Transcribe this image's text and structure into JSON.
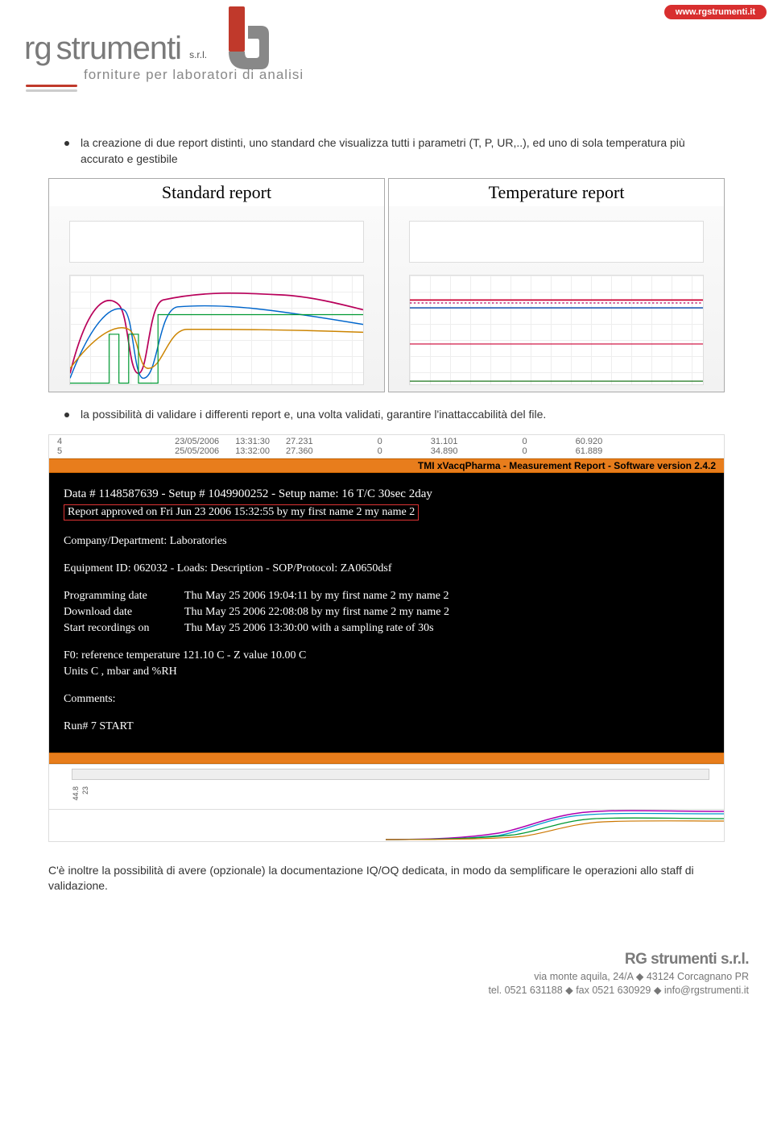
{
  "header": {
    "website": "www.rgstrumenti.it",
    "brand_rg": "rg",
    "brand_strumenti": "strumenti",
    "brand_srl": "s.r.l.",
    "tagline": "forniture per laboratori di analisi"
  },
  "bullets": {
    "b1": "la creazione di due report distinti, uno standard che visualizza tutti i parametri (T, P, UR,..), ed uno di sola temperatura più accurato e gestibile",
    "b2": "la possibilità di validare i differenti report e, una volta validati, garantire l'inattaccabilità del file."
  },
  "screenshots": {
    "left_title": "Standard report",
    "right_title": "Temperature report"
  },
  "report": {
    "top_row1_a": "4",
    "top_row1_b": "23/05/2006",
    "top_row1_c": "13:31:30",
    "top_row1_d": "27.231",
    "top_row1_e": "0",
    "top_row1_f": "31.101",
    "top_row1_g": "0",
    "top_row1_h": "60.920",
    "top_row2_a": "5",
    "top_row2_b": "25/05/2006",
    "top_row2_c": "13:32:00",
    "top_row2_d": "27.360",
    "top_row2_e": "0",
    "top_row2_f": "34.890",
    "top_row2_g": "0",
    "top_row2_h": "61.889",
    "bar_title": "TMI xVacqPharma - Measurement Report - Software version 2.4.2",
    "data_line": "Data # 1148587639  -  Setup # 1049900252  -  Setup name: 16 T/C 30sec 2day",
    "approved_line": "Report approved on Fri Jun 23 2006 15:32:55 by my first name 2 my name 2",
    "company_line": "Company/Department: Laboratories",
    "equip_line": "Equipment ID: 062032  -  Loads: Description  -  SOP/Protocol: ZA0650dsf",
    "prog_label": "Programming date",
    "prog_val": "Thu May 25 2006 19:04:11 by my first name 2 my name 2",
    "dl_label": "Download date",
    "dl_val": "Thu May 25 2006 22:08:08 by my first name 2 my name 2",
    "start_label": "Start recordings on",
    "start_val": "Thu May 25 2006 13:30:00 with a sampling rate of 30s",
    "f0_line": "F0: reference temperature 121.10 C    -  Z value 10.00 C",
    "units_line": "Units  C  , mbar  and %RH",
    "comments_line": "Comments:",
    "run_line": "Run# 7 START",
    "tick1": "44.8",
    "tick2": "23"
  },
  "final_para": "C'è inoltre la possibilità di avere (opzionale) la documentazione IQ/OQ dedicata, in modo da semplificare le operazioni allo staff di validazione.",
  "footer": {
    "brand": "RG strumenti s.r.l.",
    "addr": "via monte aquila, 24/A ◆ 43124 Corcagnano PR",
    "tel": "tel. 0521 631188 ◆ fax 0521 630929 ◆ info@rgstrumenti.it"
  }
}
